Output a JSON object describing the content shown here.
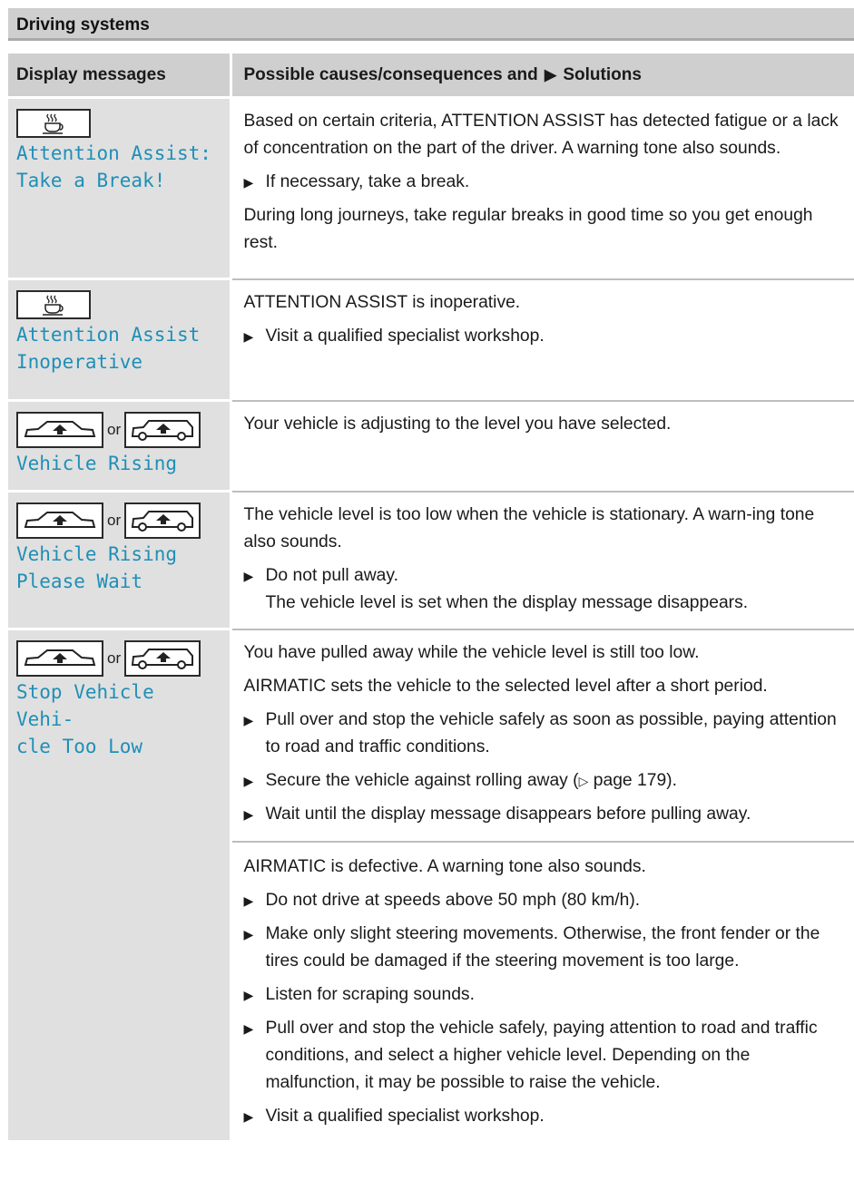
{
  "section_title": "Driving systems",
  "table": {
    "col_left": "Display messages",
    "col_right_prefix": "Possible causes/consequences and",
    "col_right_glyph": "▶",
    "col_right_suffix": "Solutions"
  },
  "or_label": "or",
  "rows": [
    {
      "icon": "coffee-cup-icon",
      "message": "Attention Assist:\nTake a Break!",
      "p1": "Based on certain criteria, ATTENTION ASSIST has detected fatigue or a lack of concentration on the part of the driver. A warning tone also sounds.",
      "s1": "If necessary, take a break.",
      "p2": "During long journeys, take regular breaks in good time so you get enough rest."
    },
    {
      "icon": "coffee-cup-icon",
      "message": "Attention Assist\nInoperative",
      "p1": "ATTENTION ASSIST is inoperative.",
      "s1": "Visit a qualified specialist workshop."
    },
    {
      "icon": "vehicle-level-icon",
      "message": "Vehicle Rising",
      "p1": "Your vehicle is adjusting to the level you have selected."
    },
    {
      "icon": "vehicle-level-icon",
      "message": "Vehicle Rising\nPlease Wait",
      "p1": "The vehicle level is too low when the vehicle is stationary. A warn-ing tone also sounds.",
      "s1": "Do not pull away.",
      "s1b": "The vehicle level is set when the display message disappears."
    },
    {
      "icon": "vehicle-level-icon",
      "message": "Stop Vehicle Vehi-\ncle Too Low",
      "p1": "You have pulled away while the vehicle level is still too low.",
      "p2": "AIRMATIC sets the vehicle to the selected level after a short period.",
      "s1": "Pull over and stop the vehicle safely as soon as possible, paying attention to road and traffic conditions.",
      "s2_prefix": "Secure the vehicle against rolling away (",
      "s2_glyph": "▷",
      "s2_suffix": " page 179).",
      "s3": "Wait until the display message disappears before pulling away.",
      "p3": "AIRMATIC is defective. A warning tone also sounds.",
      "s4": "Do not drive at speeds above 50 mph (80 km/h).",
      "s5": "Make only slight steering movements. Otherwise, the front fender or the tires could be damaged if the steering movement is too large.",
      "s6": "Listen for scraping sounds.",
      "s7": "Pull over and stop the vehicle safely, paying attention to road and traffic conditions, and select a higher vehicle level. Depending on the malfunction, it may be possible to raise the vehicle.",
      "s8": "Visit a qualified specialist workshop."
    }
  ]
}
